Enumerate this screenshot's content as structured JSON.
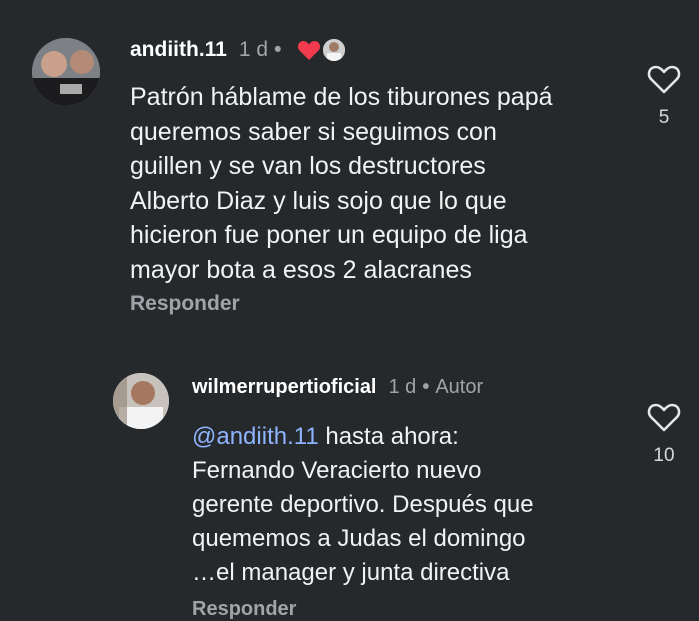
{
  "comments": [
    {
      "username": "andiith.11",
      "time": "1 d",
      "text": "Patrón háblame de los tiburones papá\nqueremos saber si seguimos con\nguillen y se van los destructores\nAlberto Diaz y luis sojo que lo que\nhicieron fue poner un equipo de liga\nmayor bota a esos 2 alacranes",
      "reply_label": "Responder",
      "like_count": "5",
      "colors": {
        "heart_badge": "#f23b4c"
      }
    },
    {
      "username": "wilmerrupertioficial",
      "time": "1 d",
      "author_label": "Autor",
      "mention": "@andiith.11",
      "text": " hasta ahora:\nFernando Veracierto nuevo\ngerente deportivo. Después que\nquememos a Judas el domingo\n…el manager y junta directiva",
      "reply_label": "Responder",
      "like_count": "10"
    }
  ],
  "icons": {
    "like": "heart-outline-icon",
    "creator_heart": "heart-filled-icon"
  }
}
